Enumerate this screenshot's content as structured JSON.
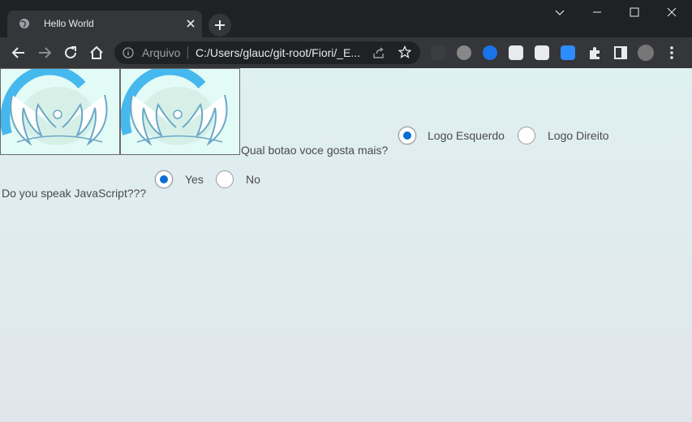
{
  "browser": {
    "tab": {
      "title": "Hello World",
      "icon": "globe-icon"
    },
    "address": {
      "scheme_label": "Arquivo",
      "url": "C:/Users/glauc/git-root/Fiori/_E..."
    }
  },
  "page": {
    "question1": {
      "text": "Qual botao voce gosta mais?",
      "options": [
        {
          "label": "Logo Esquerdo",
          "selected": true
        },
        {
          "label": "Logo Direito",
          "selected": false
        }
      ]
    },
    "question2": {
      "text": "Do you speak JavaScript???",
      "options": [
        {
          "label": "Yes",
          "selected": true
        },
        {
          "label": "No",
          "selected": false
        }
      ]
    }
  },
  "colors": {
    "radio_selected": "#0a6ed1",
    "page_bg_top": "#dff0f1",
    "page_bg_bottom": "#e1e6ec",
    "chrome_dark": "#202124"
  }
}
